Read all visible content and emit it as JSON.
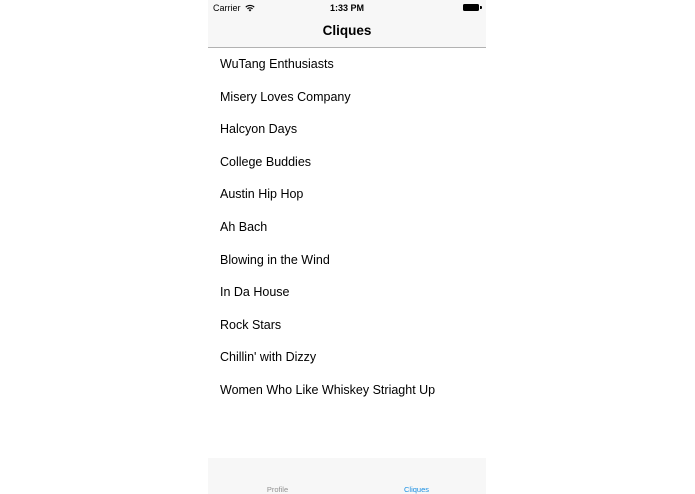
{
  "status_bar": {
    "carrier": "Carrier",
    "time": "1:33 PM",
    "icons": [
      "wifi-icon",
      "battery-icon"
    ]
  },
  "nav": {
    "title": "Cliques"
  },
  "cliques": [
    "WuTang Enthusiasts",
    "Misery Loves Company",
    "Halcyon Days",
    "College Buddies",
    "Austin Hip Hop",
    "Ah Bach",
    "Blowing in the Wind",
    "In Da House",
    "Rock Stars",
    "Chillin' with Dizzy",
    "Women Who Like Whiskey Striaght Up"
  ],
  "tab_bar": {
    "tabs": [
      {
        "label": "Profile",
        "selected": false
      },
      {
        "label": "Cliques",
        "selected": true
      }
    ],
    "selected_color": "#1a8fe3",
    "unselected_color": "#929292"
  }
}
